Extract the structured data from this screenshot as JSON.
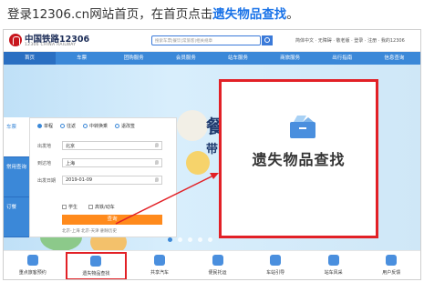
{
  "caption": {
    "prefix": "登录12306.cn网站首页，在首页点击",
    "highlight": "遗失物品查找",
    "suffix": "。"
  },
  "site": {
    "logo_title": "中国铁路12306",
    "logo_subtitle": "12306 CHINA RAILWAY",
    "search_placeholder": "搜索车票|餐饮|常旅客|相关规章",
    "top_links": "简体中文 · 无障碍 · 敬老版 · 登录 · 注册 · 我的12306"
  },
  "nav": [
    {
      "label": "首页",
      "active": true
    },
    {
      "label": "车票"
    },
    {
      "label": "团购服务"
    },
    {
      "label": "会员服务"
    },
    {
      "label": "站车服务"
    },
    {
      "label": "商旅服务"
    },
    {
      "label": "出行指南"
    },
    {
      "label": "信息查询"
    }
  ],
  "hero": {
    "text1": "餐",
    "text2": "带"
  },
  "sidetabs": [
    {
      "label": "车票",
      "active": true
    },
    {
      "label": "常用查询"
    },
    {
      "label": "订餐"
    }
  ],
  "booking_form": {
    "trip_types": [
      "单程",
      "往返",
      "中转换乘",
      "退改签"
    ],
    "from_label": "出发地",
    "from_value": "北京",
    "to_label": "到达地",
    "to_value": "上海",
    "date_label": "出发日期",
    "date_value": "2019-01-09",
    "student_label": "学生",
    "highspeed_label": "高铁/动车",
    "query_button": "查询",
    "history": "北京-上海   北京-天津   删除历史"
  },
  "callout": {
    "label": "遗失物品查找"
  },
  "features": [
    {
      "label": "重点旅客预约"
    },
    {
      "label": "遗失物品查找",
      "highlight": true
    },
    {
      "label": "共享汽车"
    },
    {
      "label": "便民托运"
    },
    {
      "label": "车站引导"
    },
    {
      "label": "站车风采"
    },
    {
      "label": "用户反馈"
    }
  ],
  "colors": {
    "accent": "#3b88d8",
    "highlight_border": "#e22026",
    "query_button": "#ff8a1c",
    "caption_highlight": "#1a73e8"
  }
}
